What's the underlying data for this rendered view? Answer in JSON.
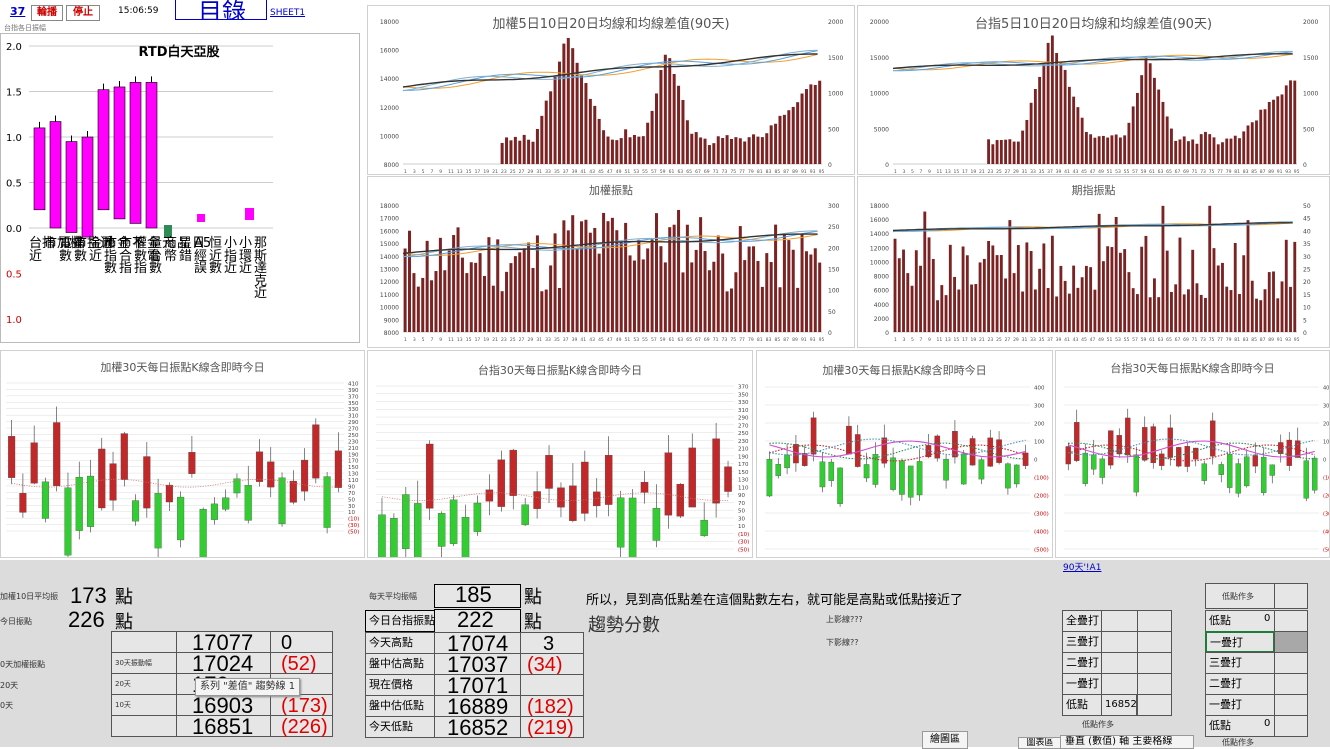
{
  "toolbar": {
    "cell_value": "37",
    "btn_rotate": "輪播",
    "btn_stop": "停止",
    "time": "15:06:59",
    "glyph_box": "目錄",
    "sheet_link": "SHEET1",
    "subtitle": "台指各日振幅"
  },
  "rtd_chart": {
    "title": "RTD白天亞股",
    "y_ticks": [
      "2.0",
      "1.5",
      "1.0",
      "0.5",
      "0.0",
      "0.5",
      "1.0"
    ],
    "y_tick_colors": [
      "#000000",
      "#000000",
      "#000000",
      "#000000",
      "#000000",
      "#cc0000",
      "#cc0000"
    ],
    "labels": [
      "台指\n近",
      "市加權",
      "電指\n數",
      "市指近\n數",
      "金融\n近",
      "市金\n指\n數",
      "市不\n合\n指",
      "權金\n數電\n指",
      "量元\n台\n數",
      "商品\n幣",
      "星日\n錯",
      "A5\n經\n誤",
      "恒\n近\n數",
      "小\n指\n近",
      "小\n環\n近",
      "那\n斯\n達\n克\n近"
    ]
  },
  "chart_tr1": {
    "title": "加權5日10日20日均線和均線差值(90天)",
    "left_ticks": [
      "18000",
      "16000",
      "14000",
      "12000",
      "10000",
      "8000"
    ],
    "right_ticks": [
      "2000",
      "1500",
      "1000",
      "500",
      "0"
    ]
  },
  "chart_tr2": {
    "title": "台指5日10日20日均線和均線差值(90天)",
    "left_ticks": [
      "20000",
      "15000",
      "10000",
      "5000",
      "0"
    ],
    "right_ticks": [
      "2000",
      "1500",
      "1000",
      "500",
      "0"
    ]
  },
  "chart_mr1": {
    "title": "加權振點",
    "left_ticks": [
      "18000",
      "17000",
      "16000",
      "15000",
      "14000",
      "13000",
      "12000",
      "11000",
      "10000",
      "9000",
      "8000"
    ],
    "right_ticks": [
      "300",
      "250",
      "200",
      "150",
      "100",
      "50",
      "0"
    ]
  },
  "chart_mr2": {
    "title": "期指振點",
    "left_ticks": [
      "18000",
      "16000",
      "14000",
      "12000",
      "10000",
      "8000",
      "6000",
      "4000",
      "2000",
      "0"
    ],
    "right_ticks": [
      "50",
      "45",
      "40",
      "35",
      "30",
      "25",
      "20",
      "15",
      "10",
      "5",
      "0"
    ]
  },
  "chart_k1": {
    "title": "加權30天每日振點K線含即時今日",
    "ticks": [
      "410",
      "390",
      "370",
      "350",
      "330",
      "310",
      "290",
      "270",
      "250",
      "230",
      "210",
      "190",
      "170",
      "150",
      "130",
      "110",
      "90",
      "70",
      "50",
      "30",
      "10",
      "(10)",
      "(30)",
      "(50)"
    ]
  },
  "chart_k2": {
    "title": "台指30天每日振點K線含即時今日",
    "ticks": [
      "370",
      "350",
      "330",
      "310",
      "290",
      "270",
      "250",
      "230",
      "210",
      "190",
      "170",
      "150",
      "130",
      "110",
      "90",
      "70",
      "50",
      "30",
      "10",
      "(10)",
      "(30)",
      "(50)"
    ]
  },
  "chart_k3": {
    "title": "加權30天每日振點K線含即時今日",
    "ticks": [
      "400",
      "300",
      "200",
      "100",
      "0",
      "(100)",
      "(200)",
      "(300)",
      "(400)",
      "(500)"
    ]
  },
  "chart_k4": {
    "title": "台指30天每日振點K線含即時今日",
    "ticks": [
      "400",
      "300",
      "200",
      "100",
      "0",
      "(100)",
      "(200)",
      "(300)",
      "(400)",
      "(500)"
    ]
  },
  "sheet": {
    "link": "90天'!A1",
    "left_label1": "加權10日平均振",
    "left_value1": "173",
    "left_unit1": "點",
    "left_label2": "今日振點",
    "left_value2": "226",
    "left_unit2": "點",
    "row_labels": [
      "0天加權振點",
      "20天",
      "0天"
    ],
    "mid_labels": [
      "30天振動幅",
      "20天",
      "10天"
    ],
    "col_a": [
      "17077",
      "17024",
      "170",
      "16903",
      "16851"
    ],
    "col_b": [
      "0",
      "(52)",
      "",
      "(173)",
      "(226)"
    ],
    "tooltip": "系列 \"差值\" 趨勢線 1",
    "right_label_top": "每天平均振幅",
    "right_value_top": "185",
    "right_unit_top": "點",
    "right_label2": "今日台指振點",
    "right_value2": "222",
    "right_unit2": "點",
    "table_labels": [
      "今天高點",
      "盤中估高點",
      "現在價格",
      "盤中估低點",
      "今天低點"
    ],
    "table_values": [
      "17074",
      "17037",
      "17071",
      "16889",
      "16852"
    ],
    "table_diff": [
      "3",
      "(34)",
      "",
      "(182)",
      "(219)"
    ],
    "note": "所以，見到高低點差在這個點數左右，就可能是高點或低點接近了",
    "trend_label": "趨勢分數",
    "up_q": "上影線???",
    "down_q": "下影線??",
    "strategy_left": [
      "全疊打",
      "三疊打",
      "二疊打",
      "一疊打",
      "低點"
    ],
    "strategy_left_low": "16852",
    "strategy_left_footer": "低點作多",
    "strategy_right_header": "低點作多",
    "strategy_right": [
      "低點",
      "一疊打",
      "三疊打",
      "二疊打",
      "一疊打",
      "低點"
    ],
    "strategy_right_vals": [
      "0",
      "",
      "",
      "",
      "",
      "0"
    ],
    "strategy_right_footer": "低點作多",
    "bottom_btn1": "繪圖區",
    "bottom_btn2": "圖表區",
    "bottom_btn3": "垂直 (數值) 軸 主要格線"
  },
  "colors": {
    "magenta": "#ff00ff",
    "bar": "#7b2222",
    "green": "#2e8b57",
    "candle_red": "#c0282a",
    "candle_green": "#33cc33"
  }
}
